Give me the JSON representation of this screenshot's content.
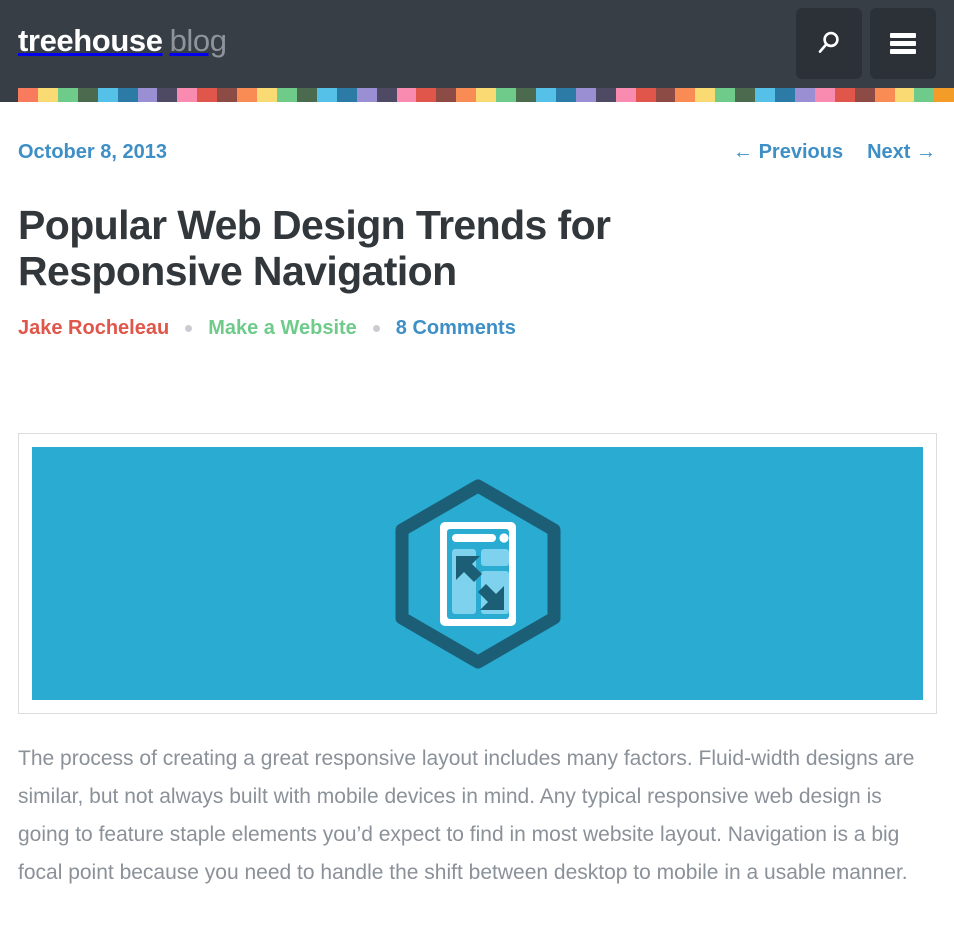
{
  "header": {
    "logo_primary": "treehouse",
    "logo_secondary": "blog",
    "search_button_label": "Search",
    "menu_button_label": "Menu",
    "background_color": "#373e45",
    "button_color": "#2b3137"
  },
  "stripe": {
    "colors": [
      "#f87b5d",
      "#fada72",
      "#6ecb8a",
      "#4c6b4e",
      "#55c0e8",
      "#2b7ba6",
      "#9b8fd4",
      "#4e4a63",
      "#f98bb0",
      "#e0564a",
      "#8c4b45",
      "#f98b55",
      "#fada72",
      "#6ecb8a",
      "#4c6b4e",
      "#55c0e8",
      "#2b7ba6",
      "#9b8fd4",
      "#4e4a63",
      "#f98bb0",
      "#e0564a",
      "#8c4b45",
      "#f98b55",
      "#fada72",
      "#6ecb8a",
      "#4c6b4e",
      "#55c0e8",
      "#2b7ba6",
      "#9b8fd4",
      "#4e4a63",
      "#f98bb0",
      "#e0564a",
      "#8c4b45",
      "#f98b55",
      "#fada72",
      "#6ecb8a",
      "#4c6b4e",
      "#55c0e8",
      "#2b7ba6",
      "#9b8fd4",
      "#f98bb0",
      "#e0564a",
      "#8c4b45",
      "#f98b55",
      "#fada72",
      "#6ecb8a",
      "#f39c28"
    ]
  },
  "post": {
    "date": "October 8, 2013",
    "nav": {
      "previous_arrow": "←",
      "previous_label": "Previous",
      "next_label": "Next",
      "next_arrow": "→"
    },
    "title": "Popular Web Design Trends for Responsive Navigation",
    "meta": {
      "author": "Jake Rocheleau",
      "category": "Make a Website",
      "comments": "8 Comments",
      "author_color": "#e0564a",
      "category_color": "#6ecb8a",
      "comments_color": "#3d8fc6"
    },
    "hero": {
      "alt": "Responsive layout hexagon badge illustration",
      "background_color": "#29abd2",
      "hexagon_stroke_color": "#1b5e75",
      "frame_color": "#ffffff",
      "panel_color": "#7fd2ee",
      "arrow_color": "#1b5e75"
    },
    "body_paragraph": "The process of creating a great responsive layout includes many factors. Fluid-width designs are similar, but not always built with mobile devices in mind. Any typical responsive web design is going to feature staple elements you’d expect to find in most website layout. Navigation is a big focal point because you need to handle the shift between desktop to mobile in a usable manner."
  }
}
